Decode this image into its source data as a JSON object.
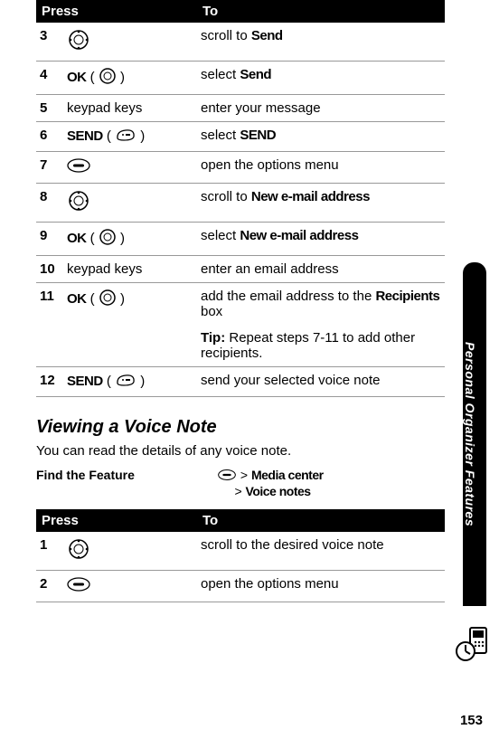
{
  "table1": {
    "head_press": "Press",
    "head_to": "To",
    "rows": [
      {
        "n": "3",
        "press_text": "",
        "icon": "nav",
        "to_pre": "scroll to ",
        "to_bold": "Send",
        "to_post": ""
      },
      {
        "n": "4",
        "press_bold": "OK",
        "press_paren": true,
        "icon": "ok",
        "to_pre": "select ",
        "to_bold": "Send",
        "to_post": ""
      },
      {
        "n": "5",
        "press_plain": "keypad keys",
        "to_pre": "enter your message",
        "to_bold": "",
        "to_post": ""
      },
      {
        "n": "6",
        "press_bold": "SEND",
        "press_paren": true,
        "icon": "soft",
        "to_pre": "select ",
        "to_bold": "SEND",
        "to_post": ""
      },
      {
        "n": "7",
        "press_text": "",
        "icon": "menu",
        "to_pre": "open the options menu",
        "to_bold": "",
        "to_post": ""
      },
      {
        "n": "8",
        "press_text": "",
        "icon": "nav",
        "to_pre": "scroll to ",
        "to_bold": "New e-mail address",
        "to_post": ""
      },
      {
        "n": "9",
        "press_bold": "OK",
        "press_paren": true,
        "icon": "ok",
        "to_pre": "select ",
        "to_bold": "New e-mail address",
        "to_post": ""
      },
      {
        "n": "10",
        "press_plain": "keypad keys",
        "to_pre": "enter an email address",
        "to_bold": "",
        "to_post": ""
      },
      {
        "n": "11",
        "press_bold": "OK",
        "press_paren": true,
        "icon": "ok",
        "to_pre": "add the email address to the ",
        "to_bold": "Recipients",
        "to_post": " box",
        "tip_label": "Tip:",
        "tip_text": " Repeat steps 7-11 to add other recipients."
      },
      {
        "n": "12",
        "press_bold": "SEND",
        "press_paren": true,
        "icon": "soft",
        "to_pre": "send your selected voice note",
        "to_bold": "",
        "to_post": ""
      }
    ]
  },
  "section_title": "Viewing a Voice Note",
  "section_intro": "You can read the details of any voice note.",
  "find_feature": {
    "label": "Find the Feature",
    "sep": ">",
    "path1": "Media center",
    "path2": "Voice notes"
  },
  "table2": {
    "head_press": "Press",
    "head_to": "To",
    "rows": [
      {
        "n": "1",
        "icon": "nav",
        "to_pre": "scroll to the desired voice note"
      },
      {
        "n": "2",
        "icon": "menu",
        "to_pre": "open the options menu"
      }
    ]
  },
  "side_label": "Personal Organizer Features",
  "page_number": "153"
}
